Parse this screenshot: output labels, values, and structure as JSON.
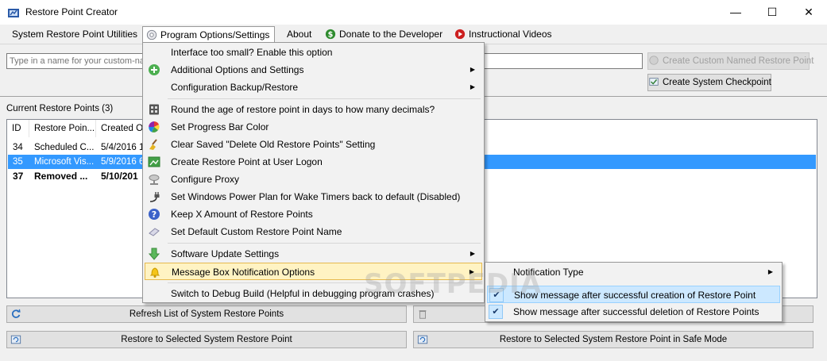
{
  "window": {
    "title": "Restore Point Creator",
    "minimize": "—",
    "maximize": "☐",
    "close": "✕"
  },
  "menubar": {
    "items": [
      {
        "label": "System Restore Point Utilities"
      },
      {
        "label": "Program Options/Settings"
      },
      {
        "label": "About"
      },
      {
        "label": "Donate to the Developer"
      },
      {
        "label": "Instructional Videos"
      }
    ]
  },
  "top_panel": {
    "name_placeholder": "Type in a name for your custom-na",
    "create_custom_label": "Create Custom Named Restore Point",
    "create_checkpoint_label": "Create System Checkpoint"
  },
  "restore_points": {
    "label": "Current Restore Points (3)",
    "columns": [
      "ID",
      "Restore Poin...",
      "Created On"
    ],
    "rows": [
      {
        "id": "34",
        "name": "Scheduled C...",
        "created": "5/4/2016 1"
      },
      {
        "id": "35",
        "name": "Microsoft Vis...",
        "created": "5/9/2016 6"
      },
      {
        "id": "37",
        "name": "Removed ...",
        "created": "5/10/201"
      }
    ]
  },
  "bottom_buttons": {
    "refresh": "Refresh List of System Restore Points",
    "restore_selected": "Restore to Selected System Restore Point",
    "restore_safe_mode": "Restore to Selected System Restore Point in Safe Mode"
  },
  "options_menu": {
    "items": [
      {
        "label": "Interface too small? Enable this option"
      },
      {
        "label": "Additional Options and Settings",
        "arrow": "▶"
      },
      {
        "label": "Configuration Backup/Restore",
        "arrow": "▶"
      },
      {
        "label": "Round the age of restore point in days to how many decimals?"
      },
      {
        "label": "Set Progress Bar Color"
      },
      {
        "label": "Clear Saved \"Delete Old Restore Points\" Setting"
      },
      {
        "label": "Create Restore Point at User Logon"
      },
      {
        "label": "Configure Proxy"
      },
      {
        "label": "Set Windows Power Plan for Wake Timers back to default (Disabled)"
      },
      {
        "label": "Keep X Amount of Restore Points"
      },
      {
        "label": "Set Default Custom Restore Point Name"
      },
      {
        "label": "Software Update Settings",
        "arrow": "▶"
      },
      {
        "label": "Message Box Notification Options",
        "arrow": "▶"
      },
      {
        "label": "Switch to Debug Build (Helpful in debugging program crashes)"
      }
    ]
  },
  "notification_submenu": {
    "items": [
      {
        "label": "Notification Type",
        "arrow": "▶"
      },
      {
        "label": "Show message after successful creation of Restore Point",
        "check": "✔"
      },
      {
        "label": "Show message after successful deletion of Restore Points",
        "check": "✔"
      }
    ]
  },
  "watermark": "SOFTPEDIA"
}
